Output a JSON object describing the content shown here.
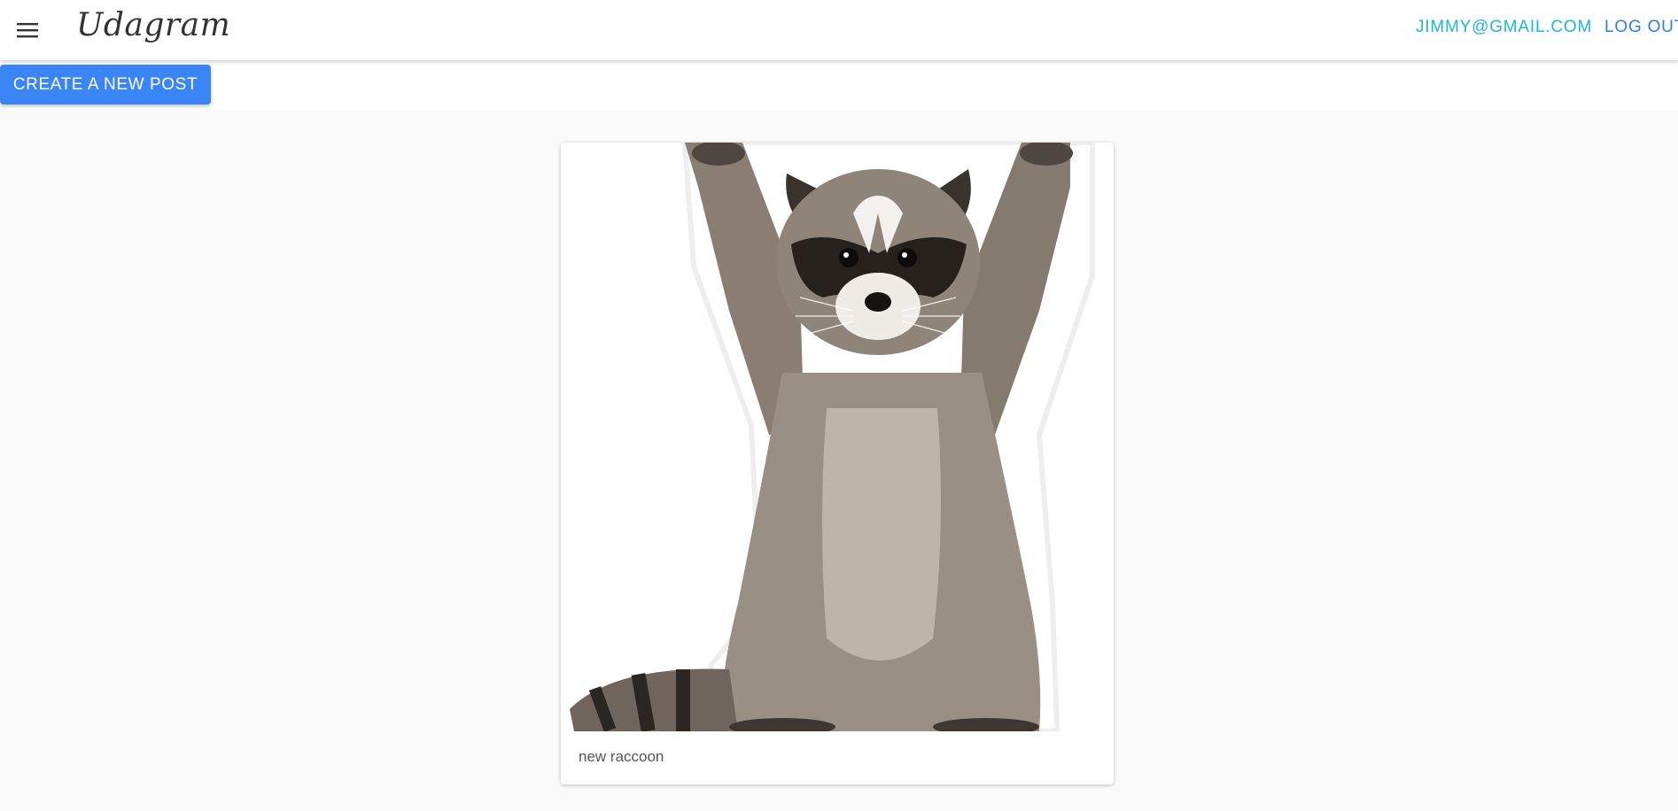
{
  "app": {
    "brand": "Udagram",
    "menu_icon": "menu-icon"
  },
  "header": {
    "user_email": "JIMMY@GMAIL.COM",
    "logout_label": "LOG OUT"
  },
  "actions": {
    "create_post_label": "CREATE A NEW POST"
  },
  "feed": {
    "posts": [
      {
        "caption": "new raccoon",
        "image_subject": "raccoon"
      }
    ]
  },
  "colors": {
    "primary": "#3b86f7",
    "email_link": "#1fb6d6",
    "logout_link": "#2f7fe0",
    "background": "#fafafa"
  }
}
